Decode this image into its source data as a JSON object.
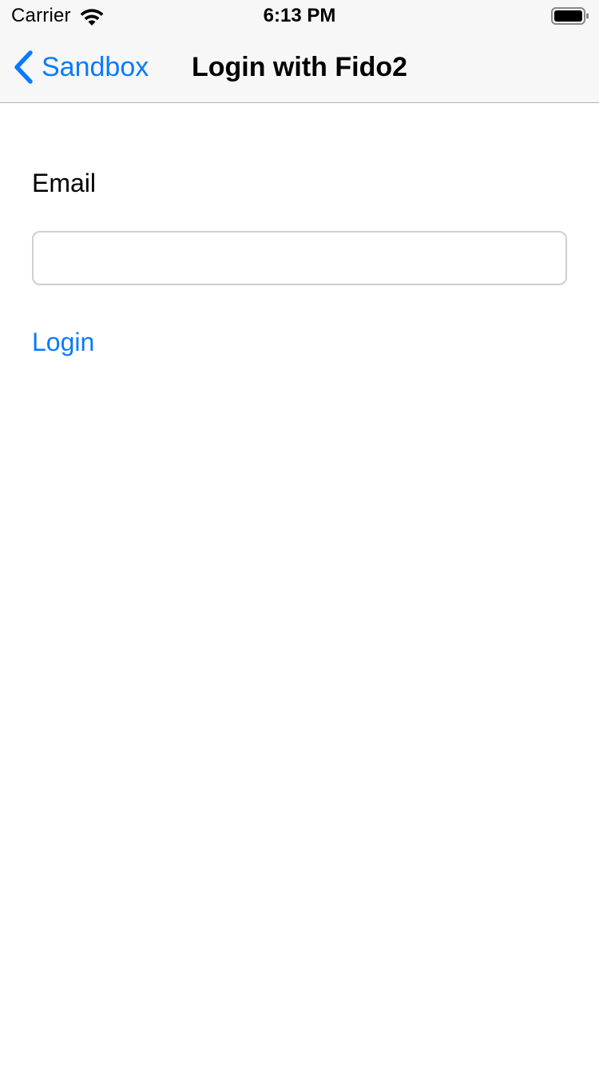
{
  "status_bar": {
    "carrier": "Carrier",
    "time": "6:13 PM"
  },
  "nav": {
    "back_label": "Sandbox",
    "title": "Login with Fido2"
  },
  "form": {
    "email_label": "Email",
    "email_value": "",
    "login_label": "Login"
  },
  "colors": {
    "accent": "#0a7aff",
    "nav_background": "#f7f7f7",
    "input_border": "#cfcfcf"
  },
  "icons": {
    "back": "chevron-left-icon",
    "wifi": "wifi-icon",
    "battery": "battery-icon"
  }
}
